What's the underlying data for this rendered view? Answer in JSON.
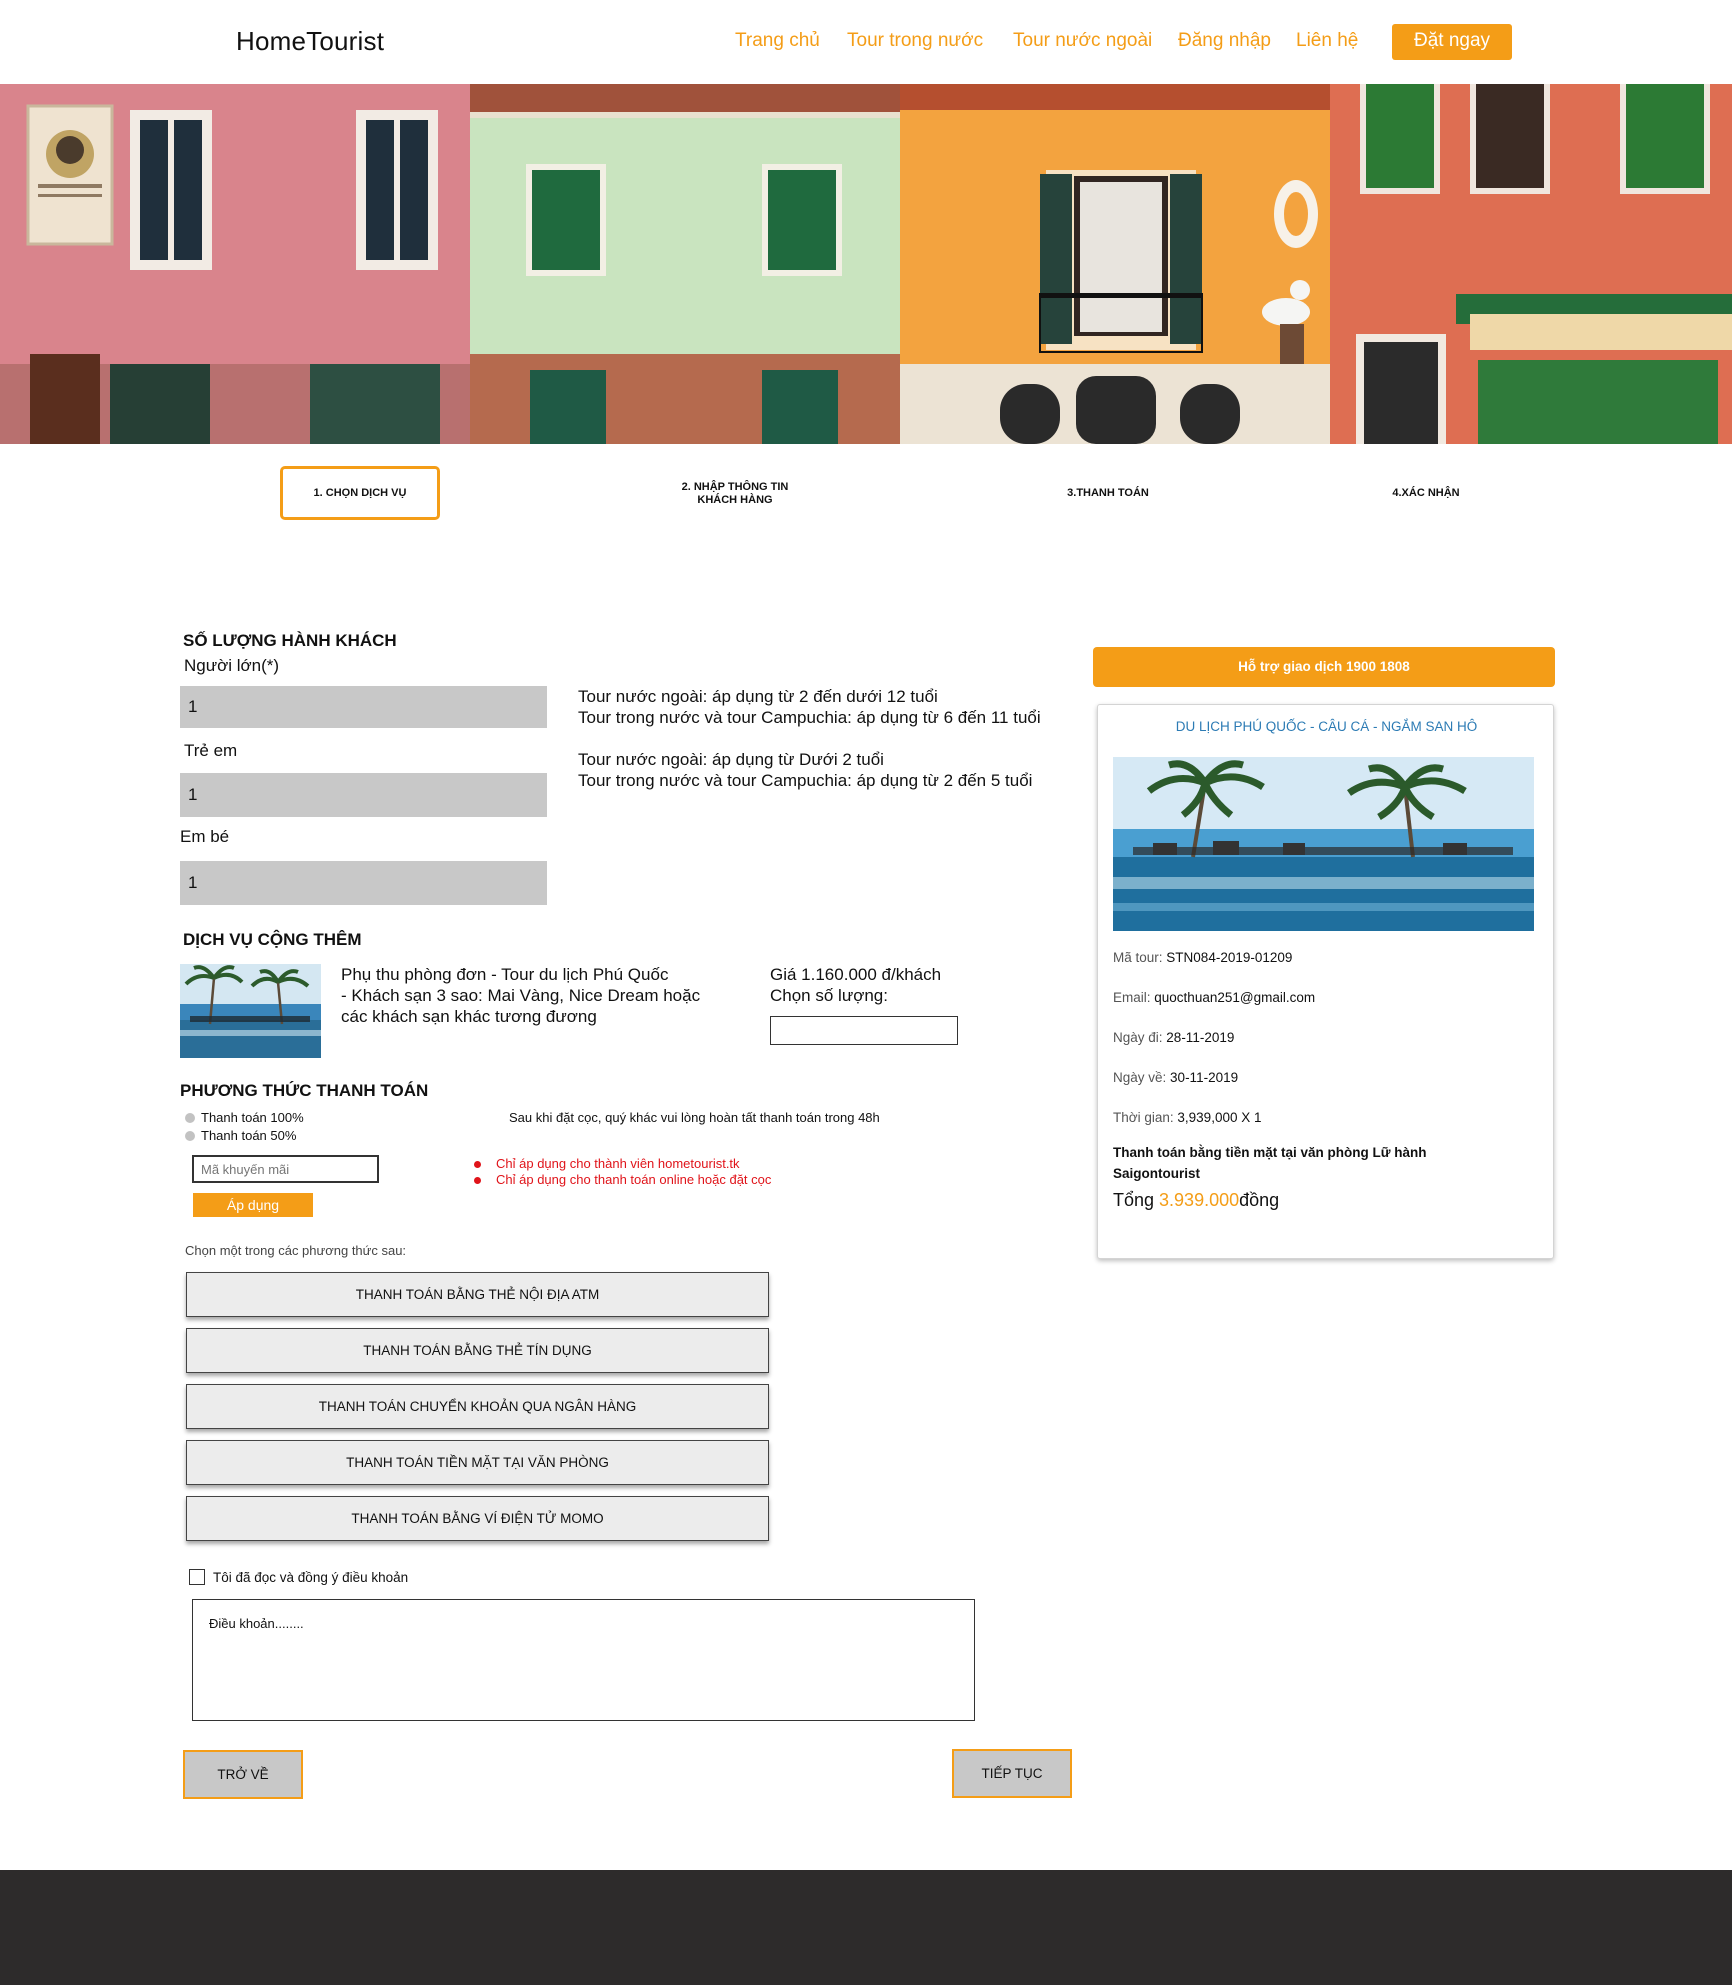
{
  "header": {
    "brand": "HomeTourist",
    "nav": [
      "Trang chủ",
      "Tour trong nước",
      "Tour nước ngoài",
      "Đăng nhập",
      "Liên hệ"
    ],
    "cta": "Đặt ngay"
  },
  "steps": {
    "s1": "1. CHỌN DỊCH VỤ",
    "s2_line1": "2. NHẬP THÔNG TIN",
    "s2_line2": "KHÁCH HÀNG",
    "s3": "3.THANH TOÁN",
    "s4": "4.XÁC NHẬN",
    "active": 1
  },
  "passengers": {
    "title": "SỐ LƯỢNG HÀNH KHÁCH",
    "adult_label": "Người lớn(*)",
    "adult_value": "1",
    "child_label": "Trẻ em",
    "child_value": "1",
    "infant_label": "Em bé",
    "infant_value": "1",
    "child_note_1": "Tour nước ngoài: áp dụng từ 2 đến dưới 12 tuổi",
    "child_note_2": "Tour trong nước và tour Campuchia: áp dụng từ 6 đến 11 tuổi",
    "infant_note_1": "Tour nước ngoài: áp dụng từ Dưới 2 tuổi",
    "infant_note_2": "Tour trong nước và tour Campuchia: áp dụng từ 2 đến 5 tuổi"
  },
  "addon": {
    "title": "DỊCH VỤ CỘNG THÊM",
    "desc_1": "Phụ thu phòng đơn - Tour du lịch Phú Quốc",
    "desc_2": "- Khách sạn 3 sao:  Mai Vàng, Nice Dream hoặc",
    "desc_3": "các khách sạn khác tương đương",
    "price": "Giá 1.160.000 đ/khách",
    "qty_label": "Chọn số lượng:"
  },
  "payment": {
    "title": "PHƯƠNG THỨC THANH TOÁN",
    "option_full": "Thanh toán 100%",
    "option_half": "Thanh toán 50%",
    "deposit_note": "Sau khi đặt cọc, quý khác vui lòng hoàn tất thanh toán trong 48h",
    "promo_placeholder": "Mã khuyến mãi",
    "apply": "Áp dụng",
    "promo_rule_1": "Chỉ áp dụng cho thành viên hometourist.tk",
    "promo_rule_2": "Chỉ áp dụng cho thanh toán online hoặc đặt cọc",
    "choose_label": "Chọn một trong các phương thức sau:",
    "methods": [
      "THANH TOÁN BẰNG THẺ NỘI ĐỊA ATM",
      "THANH TOÁN BẰNG THẺ TÍN DỤNG",
      "THANH TOÁN CHUYỂN KHOẢN QUA NGÂN HÀNG",
      "THANH TOÁN TIỀN MẶT TẠI VĂN PHÒNG",
      "THANH TOÁN BẰNG VÍ ĐIỆN TỬ MOMO"
    ],
    "agree_label": "Tôi đã đọc và đồng ý điều khoản",
    "terms_text": "Điều khoản........",
    "back": "TRỞ VỀ",
    "next": "TIẾP TỤC"
  },
  "summary": {
    "support": "Hỗ trợ giao dịch 1900 1808",
    "tour_title": "DU LỊCH PHÚ QUỐC - CÂU CÁ - NGẮM SAN HÔ",
    "code_label": "Mã tour:",
    "code": "STN084-2019-01209",
    "email_label": "Email:",
    "email": "quocthuan251@gmail.com",
    "depart_label": "Ngày đi:",
    "depart": "28-11-2019",
    "return_label": "Ngày về:",
    "return": "30-11-2019",
    "duration_label": "Thời gian:",
    "duration": "3,939,000 X 1",
    "pay_note_1": "Thanh toán bằng tiền mặt tại văn phòng Lữ hành",
    "pay_note_2": "Saigontourist",
    "total_prefix": "Tổng ",
    "total_amount": "3.939.000",
    "total_suffix": "đồng"
  },
  "colors": {
    "accent": "#f49d17",
    "link_blue": "#2c7bb4",
    "warning_red": "#e0141a",
    "footer": "#2d2b2b"
  }
}
